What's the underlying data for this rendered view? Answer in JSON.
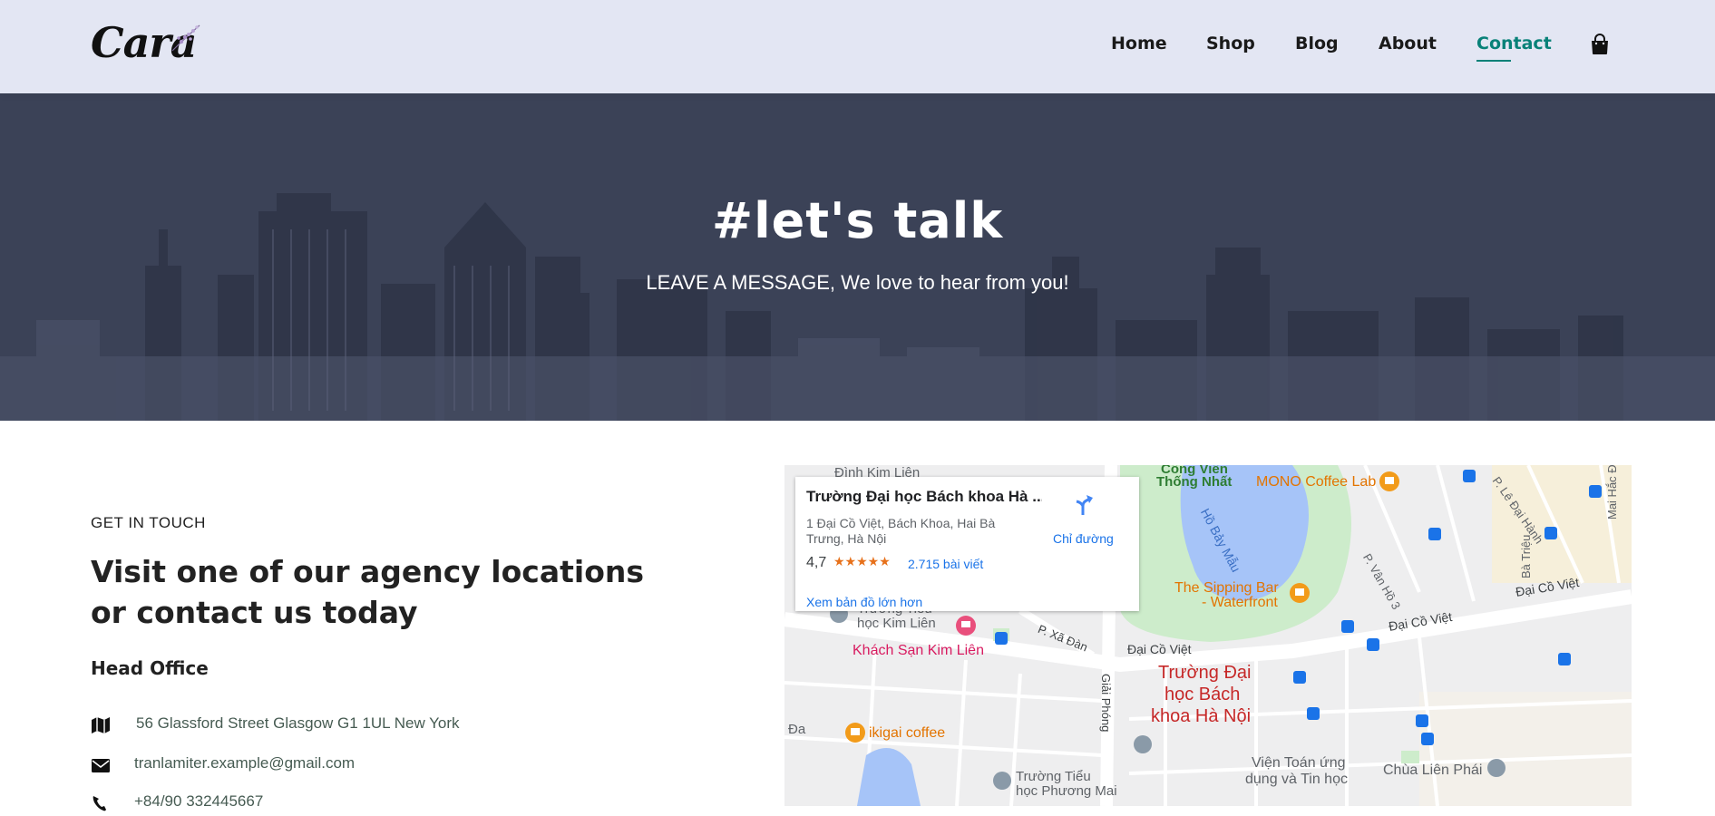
{
  "brand": {
    "logo_text": "Cara"
  },
  "nav": {
    "items": [
      {
        "label": "Home"
      },
      {
        "label": "Shop"
      },
      {
        "label": "Blog"
      },
      {
        "label": "About"
      },
      {
        "label": "Contact",
        "active": true
      }
    ],
    "cart_icon": "shopping-bag-icon"
  },
  "hero": {
    "title": "#let's talk",
    "subtitle": "LEAVE A MESSAGE, We love to hear from you!"
  },
  "contact": {
    "eyebrow": "GET IN TOUCH",
    "headline": "Visit one of our agency locations or contact us today",
    "office_heading": "Head Office",
    "details": [
      {
        "icon": "map-icon",
        "text": "56 Glassford Street Glasgow G1 1UL New York"
      },
      {
        "icon": "envelope-icon",
        "text": "tranlamiter.example@gmail.com"
      },
      {
        "icon": "phone-icon",
        "text": "+84/90 332445667"
      }
    ]
  },
  "map": {
    "card": {
      "title": "Trường Đại học Bách khoa Hà ...",
      "address": "1 Đại Cồ Việt, Bách Khoa, Hai Bà Trưng, Hà Nội",
      "rating": "4,7",
      "stars": 4.7,
      "reviews": "2.715 bài viết",
      "larger_map": "Xem bản đồ lớn hơn",
      "directions": "Chỉ đường"
    },
    "labels": {
      "dinh_kim_lien": "Đình Kim Liên",
      "cong_vien": "Công Viên",
      "thong_nhat": "Thống Nhất",
      "ho_bay_mau": "Hồ Bảy Mẫu",
      "mono": "MONO Coffee Lab",
      "le_dai_hanh": "P. Lê Đại Hành",
      "mai_hac_de": "Mai Hắc Đế",
      "ba_trieu": "Bà Triệu",
      "van_ho": "P. Vân Hồ 3",
      "sipping_1": "The Sipping Bar",
      "sipping_2": "- Waterfront",
      "dai_co_viet_1": "Đại Cồ Việt",
      "dai_co_viet_2": "Đại Cồ Việt",
      "dai_co_viet_3": "Đại Cồ Việt",
      "tieu_hoc_1": "Trường Tiểu",
      "tieu_hoc_2": "học Kim Liên",
      "khach_san": "Khách Sạn Kim Liên",
      "xa_dan": "P. Xã Đàn",
      "giai_phong": "Giải Phóng",
      "bk_1": "Trường Đại",
      "bk_2": "học Bách",
      "bk_3": "khoa Hà Nội",
      "da": "Đa",
      "ikigai": "ikigai coffee",
      "toan_1": "Viện Toán ứng",
      "toan_2": "dụng và Tin học",
      "chua": "Chùa Liên Phái",
      "pm_1": "Trường Tiểu",
      "pm_2": "học Phương Mai"
    }
  }
}
